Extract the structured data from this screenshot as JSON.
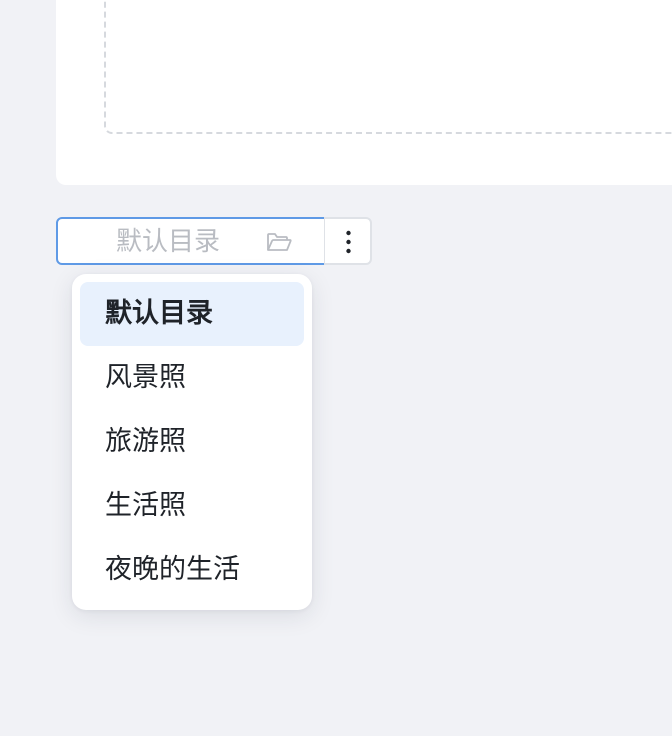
{
  "folder_select": {
    "value": "默认目录",
    "icon": "folder-open-icon"
  },
  "more_button": {
    "icon": "more-vertical-icon"
  },
  "dropdown": {
    "selected_index": 0,
    "items": [
      {
        "label": "默认目录"
      },
      {
        "label": "风景照"
      },
      {
        "label": "旅游照"
      },
      {
        "label": "生活照"
      },
      {
        "label": "夜晚的生活"
      }
    ]
  },
  "colors": {
    "page_background": "#f1f2f6",
    "accent_border": "#5f9ae6",
    "selected_item_background": "#e8f1fd",
    "placeholder_text": "#b9bcc2",
    "menu_text": "#1f2329"
  }
}
